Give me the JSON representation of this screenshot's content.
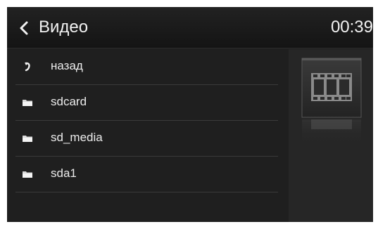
{
  "header": {
    "title": "Видео",
    "clock": "00:39",
    "back_icon": "chevron-left-icon"
  },
  "list": {
    "items": [
      {
        "label": "назад",
        "icon": "back-arrow-icon"
      },
      {
        "label": "sdcard",
        "icon": "folder-icon"
      },
      {
        "label": "sd_media",
        "icon": "folder-icon"
      },
      {
        "label": "sda1",
        "icon": "folder-icon"
      }
    ]
  },
  "preview": {
    "icon": "film-strip-icon"
  },
  "colors": {
    "background": "#1d1d1d",
    "header": "#1a1a1a",
    "text": "#ececec",
    "divider": "#3a3a3a",
    "preview_panel": "#262626"
  }
}
